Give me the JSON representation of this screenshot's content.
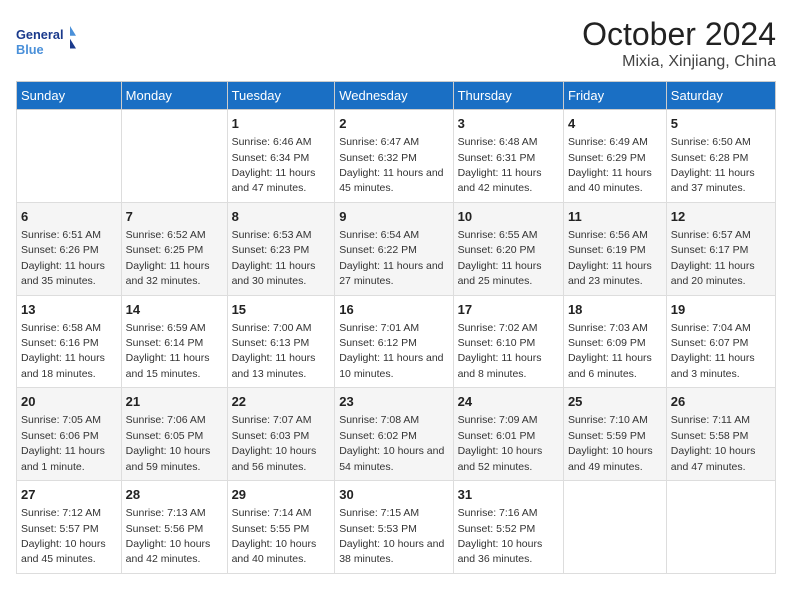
{
  "header": {
    "logo_text_line1": "General",
    "logo_text_line2": "Blue",
    "month_year": "October 2024",
    "location": "Mixia, Xinjiang, China"
  },
  "days_of_week": [
    "Sunday",
    "Monday",
    "Tuesday",
    "Wednesday",
    "Thursday",
    "Friday",
    "Saturday"
  ],
  "weeks": [
    [
      {
        "day": null
      },
      {
        "day": null
      },
      {
        "day": "1",
        "sunrise": "6:46 AM",
        "sunset": "6:34 PM",
        "daylight": "11 hours and 47 minutes."
      },
      {
        "day": "2",
        "sunrise": "6:47 AM",
        "sunset": "6:32 PM",
        "daylight": "11 hours and 45 minutes."
      },
      {
        "day": "3",
        "sunrise": "6:48 AM",
        "sunset": "6:31 PM",
        "daylight": "11 hours and 42 minutes."
      },
      {
        "day": "4",
        "sunrise": "6:49 AM",
        "sunset": "6:29 PM",
        "daylight": "11 hours and 40 minutes."
      },
      {
        "day": "5",
        "sunrise": "6:50 AM",
        "sunset": "6:28 PM",
        "daylight": "11 hours and 37 minutes."
      }
    ],
    [
      {
        "day": "6",
        "sunrise": "6:51 AM",
        "sunset": "6:26 PM",
        "daylight": "11 hours and 35 minutes."
      },
      {
        "day": "7",
        "sunrise": "6:52 AM",
        "sunset": "6:25 PM",
        "daylight": "11 hours and 32 minutes."
      },
      {
        "day": "8",
        "sunrise": "6:53 AM",
        "sunset": "6:23 PM",
        "daylight": "11 hours and 30 minutes."
      },
      {
        "day": "9",
        "sunrise": "6:54 AM",
        "sunset": "6:22 PM",
        "daylight": "11 hours and 27 minutes."
      },
      {
        "day": "10",
        "sunrise": "6:55 AM",
        "sunset": "6:20 PM",
        "daylight": "11 hours and 25 minutes."
      },
      {
        "day": "11",
        "sunrise": "6:56 AM",
        "sunset": "6:19 PM",
        "daylight": "11 hours and 23 minutes."
      },
      {
        "day": "12",
        "sunrise": "6:57 AM",
        "sunset": "6:17 PM",
        "daylight": "11 hours and 20 minutes."
      }
    ],
    [
      {
        "day": "13",
        "sunrise": "6:58 AM",
        "sunset": "6:16 PM",
        "daylight": "11 hours and 18 minutes."
      },
      {
        "day": "14",
        "sunrise": "6:59 AM",
        "sunset": "6:14 PM",
        "daylight": "11 hours and 15 minutes."
      },
      {
        "day": "15",
        "sunrise": "7:00 AM",
        "sunset": "6:13 PM",
        "daylight": "11 hours and 13 minutes."
      },
      {
        "day": "16",
        "sunrise": "7:01 AM",
        "sunset": "6:12 PM",
        "daylight": "11 hours and 10 minutes."
      },
      {
        "day": "17",
        "sunrise": "7:02 AM",
        "sunset": "6:10 PM",
        "daylight": "11 hours and 8 minutes."
      },
      {
        "day": "18",
        "sunrise": "7:03 AM",
        "sunset": "6:09 PM",
        "daylight": "11 hours and 6 minutes."
      },
      {
        "day": "19",
        "sunrise": "7:04 AM",
        "sunset": "6:07 PM",
        "daylight": "11 hours and 3 minutes."
      }
    ],
    [
      {
        "day": "20",
        "sunrise": "7:05 AM",
        "sunset": "6:06 PM",
        "daylight": "11 hours and 1 minute."
      },
      {
        "day": "21",
        "sunrise": "7:06 AM",
        "sunset": "6:05 PM",
        "daylight": "10 hours and 59 minutes."
      },
      {
        "day": "22",
        "sunrise": "7:07 AM",
        "sunset": "6:03 PM",
        "daylight": "10 hours and 56 minutes."
      },
      {
        "day": "23",
        "sunrise": "7:08 AM",
        "sunset": "6:02 PM",
        "daylight": "10 hours and 54 minutes."
      },
      {
        "day": "24",
        "sunrise": "7:09 AM",
        "sunset": "6:01 PM",
        "daylight": "10 hours and 52 minutes."
      },
      {
        "day": "25",
        "sunrise": "7:10 AM",
        "sunset": "5:59 PM",
        "daylight": "10 hours and 49 minutes."
      },
      {
        "day": "26",
        "sunrise": "7:11 AM",
        "sunset": "5:58 PM",
        "daylight": "10 hours and 47 minutes."
      }
    ],
    [
      {
        "day": "27",
        "sunrise": "7:12 AM",
        "sunset": "5:57 PM",
        "daylight": "10 hours and 45 minutes."
      },
      {
        "day": "28",
        "sunrise": "7:13 AM",
        "sunset": "5:56 PM",
        "daylight": "10 hours and 42 minutes."
      },
      {
        "day": "29",
        "sunrise": "7:14 AM",
        "sunset": "5:55 PM",
        "daylight": "10 hours and 40 minutes."
      },
      {
        "day": "30",
        "sunrise": "7:15 AM",
        "sunset": "5:53 PM",
        "daylight": "10 hours and 38 minutes."
      },
      {
        "day": "31",
        "sunrise": "7:16 AM",
        "sunset": "5:52 PM",
        "daylight": "10 hours and 36 minutes."
      },
      {
        "day": null
      },
      {
        "day": null
      }
    ]
  ],
  "labels": {
    "sunrise": "Sunrise:",
    "sunset": "Sunset:",
    "daylight": "Daylight:"
  }
}
